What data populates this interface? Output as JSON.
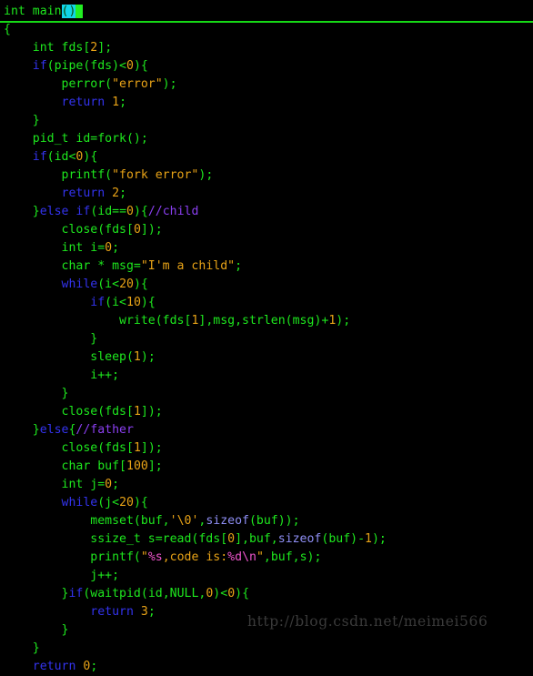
{
  "app": {
    "kind": "terminal-code-editor",
    "background": "#000000",
    "default_text_color": "#1ee81e"
  },
  "colors": {
    "plain": "#1ee81e",
    "keyword": "#3333ee",
    "number": "#e8a317",
    "string": "#e8a317",
    "format_specifier": "#ee55cc",
    "comment": "#8a3ff0",
    "builtin": "#8f8ff5",
    "selection_background": "#11d5e8",
    "cursor_background": "#22ee22",
    "current_line_rule": "#16d916",
    "watermark": "#3a3a3a"
  },
  "cursor": {
    "line_index": 0,
    "selected_text": "()",
    "block_char": " "
  },
  "watermark": {
    "text": "http://blog.csdn.net/meimei566"
  },
  "code": {
    "language": "c",
    "lines": [
      {
        "current": true,
        "tokens": [
          {
            "t": "int main",
            "c": "plain"
          },
          {
            "t": "()",
            "c": "selection"
          },
          {
            "t": " ",
            "c": "cursor"
          }
        ]
      },
      {
        "tokens": [
          {
            "t": "{",
            "c": "plain"
          }
        ]
      },
      {
        "tokens": [
          {
            "t": "    int fds",
            "c": "plain"
          },
          {
            "t": "[",
            "c": "plain"
          },
          {
            "t": "2",
            "c": "number"
          },
          {
            "t": "];",
            "c": "plain"
          }
        ]
      },
      {
        "tokens": [
          {
            "t": "    ",
            "c": "plain"
          },
          {
            "t": "if",
            "c": "keyword"
          },
          {
            "t": "(pipe(fds)<",
            "c": "plain"
          },
          {
            "t": "0",
            "c": "number"
          },
          {
            "t": "){",
            "c": "plain"
          }
        ]
      },
      {
        "tokens": [
          {
            "t": "        perror(",
            "c": "plain"
          },
          {
            "t": "\"error\"",
            "c": "string"
          },
          {
            "t": ");",
            "c": "plain"
          }
        ]
      },
      {
        "tokens": [
          {
            "t": "        ",
            "c": "plain"
          },
          {
            "t": "return",
            "c": "keyword"
          },
          {
            "t": " ",
            "c": "plain"
          },
          {
            "t": "1",
            "c": "number"
          },
          {
            "t": ";",
            "c": "plain"
          }
        ]
      },
      {
        "tokens": [
          {
            "t": "    }",
            "c": "plain"
          }
        ]
      },
      {
        "tokens": [
          {
            "t": "    pid_t id=fork();",
            "c": "plain"
          }
        ]
      },
      {
        "tokens": [
          {
            "t": "    ",
            "c": "plain"
          },
          {
            "t": "if",
            "c": "keyword"
          },
          {
            "t": "(id<",
            "c": "plain"
          },
          {
            "t": "0",
            "c": "number"
          },
          {
            "t": "){",
            "c": "plain"
          }
        ]
      },
      {
        "tokens": [
          {
            "t": "        printf(",
            "c": "plain"
          },
          {
            "t": "\"fork error\"",
            "c": "string"
          },
          {
            "t": ");",
            "c": "plain"
          }
        ]
      },
      {
        "tokens": [
          {
            "t": "        ",
            "c": "plain"
          },
          {
            "t": "return",
            "c": "keyword"
          },
          {
            "t": " ",
            "c": "plain"
          },
          {
            "t": "2",
            "c": "number"
          },
          {
            "t": ";",
            "c": "plain"
          }
        ]
      },
      {
        "tokens": [
          {
            "t": "    }",
            "c": "plain"
          },
          {
            "t": "else",
            "c": "keyword"
          },
          {
            "t": " ",
            "c": "plain"
          },
          {
            "t": "if",
            "c": "keyword"
          },
          {
            "t": "(id==",
            "c": "plain"
          },
          {
            "t": "0",
            "c": "number"
          },
          {
            "t": "){",
            "c": "plain"
          },
          {
            "t": "//child",
            "c": "comment"
          }
        ]
      },
      {
        "tokens": [
          {
            "t": "        close(fds",
            "c": "plain"
          },
          {
            "t": "[",
            "c": "plain"
          },
          {
            "t": "0",
            "c": "number"
          },
          {
            "t": "]);",
            "c": "plain"
          }
        ]
      },
      {
        "tokens": [
          {
            "t": "        int i=",
            "c": "plain"
          },
          {
            "t": "0",
            "c": "number"
          },
          {
            "t": ";",
            "c": "plain"
          }
        ]
      },
      {
        "tokens": [
          {
            "t": "        char * msg=",
            "c": "plain"
          },
          {
            "t": "\"I'm a child\"",
            "c": "string"
          },
          {
            "t": ";",
            "c": "plain"
          }
        ]
      },
      {
        "tokens": [
          {
            "t": "        ",
            "c": "plain"
          },
          {
            "t": "while",
            "c": "keyword"
          },
          {
            "t": "(i<",
            "c": "plain"
          },
          {
            "t": "20",
            "c": "number"
          },
          {
            "t": "){",
            "c": "plain"
          }
        ]
      },
      {
        "tokens": [
          {
            "t": "            ",
            "c": "plain"
          },
          {
            "t": "if",
            "c": "keyword"
          },
          {
            "t": "(i<",
            "c": "plain"
          },
          {
            "t": "10",
            "c": "number"
          },
          {
            "t": "){",
            "c": "plain"
          }
        ]
      },
      {
        "tokens": [
          {
            "t": "                write(fds",
            "c": "plain"
          },
          {
            "t": "[",
            "c": "plain"
          },
          {
            "t": "1",
            "c": "number"
          },
          {
            "t": "],msg,strlen(msg)+",
            "c": "plain"
          },
          {
            "t": "1",
            "c": "number"
          },
          {
            "t": ");",
            "c": "plain"
          }
        ]
      },
      {
        "tokens": [
          {
            "t": "            }",
            "c": "plain"
          }
        ]
      },
      {
        "tokens": [
          {
            "t": "            sleep(",
            "c": "plain"
          },
          {
            "t": "1",
            "c": "number"
          },
          {
            "t": ");",
            "c": "plain"
          }
        ]
      },
      {
        "tokens": [
          {
            "t": "            i++;",
            "c": "plain"
          }
        ]
      },
      {
        "tokens": [
          {
            "t": "        }",
            "c": "plain"
          }
        ]
      },
      {
        "tokens": [
          {
            "t": "        close(fds",
            "c": "plain"
          },
          {
            "t": "[",
            "c": "plain"
          },
          {
            "t": "1",
            "c": "number"
          },
          {
            "t": "]);",
            "c": "plain"
          }
        ]
      },
      {
        "tokens": [
          {
            "t": "    }",
            "c": "plain"
          },
          {
            "t": "else",
            "c": "keyword"
          },
          {
            "t": "{",
            "c": "plain"
          },
          {
            "t": "//father",
            "c": "comment"
          }
        ]
      },
      {
        "tokens": [
          {
            "t": "        close(fds",
            "c": "plain"
          },
          {
            "t": "[",
            "c": "plain"
          },
          {
            "t": "1",
            "c": "number"
          },
          {
            "t": "]);",
            "c": "plain"
          }
        ]
      },
      {
        "tokens": [
          {
            "t": "        char buf",
            "c": "plain"
          },
          {
            "t": "[",
            "c": "plain"
          },
          {
            "t": "100",
            "c": "number"
          },
          {
            "t": "];",
            "c": "plain"
          }
        ]
      },
      {
        "tokens": [
          {
            "t": "        int j=",
            "c": "plain"
          },
          {
            "t": "0",
            "c": "number"
          },
          {
            "t": ";",
            "c": "plain"
          }
        ]
      },
      {
        "tokens": [
          {
            "t": "        ",
            "c": "plain"
          },
          {
            "t": "while",
            "c": "keyword"
          },
          {
            "t": "(j<",
            "c": "plain"
          },
          {
            "t": "20",
            "c": "number"
          },
          {
            "t": "){",
            "c": "plain"
          }
        ]
      },
      {
        "tokens": [
          {
            "t": "            memset(buf,",
            "c": "plain"
          },
          {
            "t": "'\\0'",
            "c": "string"
          },
          {
            "t": ",",
            "c": "plain"
          },
          {
            "t": "sizeof",
            "c": "builtin"
          },
          {
            "t": "(buf));",
            "c": "plain"
          }
        ]
      },
      {
        "tokens": [
          {
            "t": "            ssize_t s=read(fds",
            "c": "plain"
          },
          {
            "t": "[",
            "c": "plain"
          },
          {
            "t": "0",
            "c": "number"
          },
          {
            "t": "],buf,",
            "c": "plain"
          },
          {
            "t": "sizeof",
            "c": "builtin"
          },
          {
            "t": "(buf)-",
            "c": "plain"
          },
          {
            "t": "1",
            "c": "number"
          },
          {
            "t": ");",
            "c": "plain"
          }
        ]
      },
      {
        "tokens": [
          {
            "t": "            printf(",
            "c": "plain"
          },
          {
            "t": "\"",
            "c": "string"
          },
          {
            "t": "%s",
            "c": "format"
          },
          {
            "t": ",code is:",
            "c": "string"
          },
          {
            "t": "%d",
            "c": "format"
          },
          {
            "t": "\\n",
            "c": "format"
          },
          {
            "t": "\"",
            "c": "string"
          },
          {
            "t": ",buf,s);",
            "c": "plain"
          }
        ]
      },
      {
        "tokens": [
          {
            "t": "            j++;",
            "c": "plain"
          }
        ]
      },
      {
        "tokens": [
          {
            "t": "        }",
            "c": "plain"
          },
          {
            "t": "if",
            "c": "keyword"
          },
          {
            "t": "(waitpid(id,NULL,",
            "c": "plain"
          },
          {
            "t": "0",
            "c": "number"
          },
          {
            "t": ")<",
            "c": "plain"
          },
          {
            "t": "0",
            "c": "number"
          },
          {
            "t": "){",
            "c": "plain"
          }
        ]
      },
      {
        "tokens": [
          {
            "t": "            ",
            "c": "plain"
          },
          {
            "t": "return",
            "c": "keyword"
          },
          {
            "t": " ",
            "c": "plain"
          },
          {
            "t": "3",
            "c": "number"
          },
          {
            "t": ";",
            "c": "plain"
          }
        ]
      },
      {
        "tokens": [
          {
            "t": "        }",
            "c": "plain"
          }
        ]
      },
      {
        "tokens": [
          {
            "t": "    }",
            "c": "plain"
          }
        ]
      },
      {
        "tokens": [
          {
            "t": "    ",
            "c": "plain"
          },
          {
            "t": "return",
            "c": "keyword"
          },
          {
            "t": " ",
            "c": "plain"
          },
          {
            "t": "0",
            "c": "number"
          },
          {
            "t": ";",
            "c": "plain"
          }
        ]
      }
    ]
  }
}
